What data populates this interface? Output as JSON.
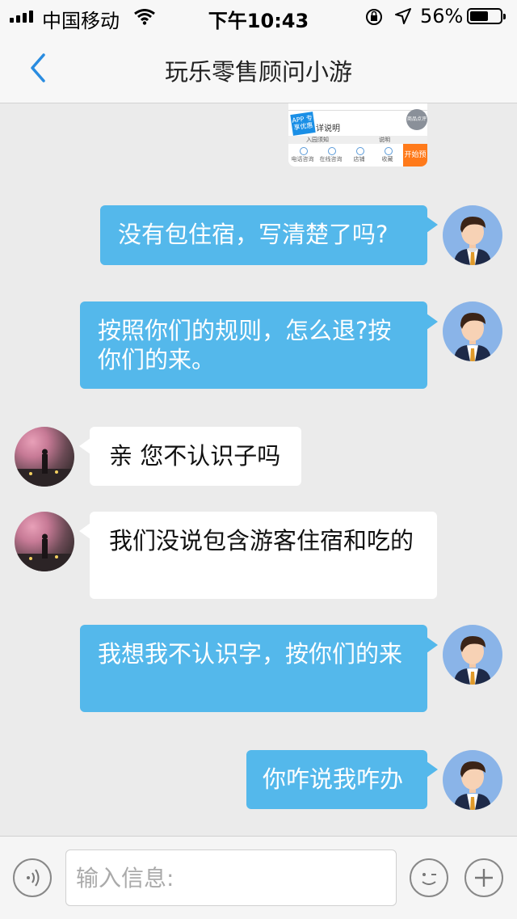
{
  "status_bar": {
    "carrier": "中国移动",
    "time": "下午10:43",
    "battery_percent": "56%"
  },
  "nav": {
    "title": "玩乐零售顾问小游"
  },
  "shared_screenshot": {
    "badge": "APP 专享优惠",
    "desc": "详说明",
    "row_left": "入园须知",
    "row_right": "说明",
    "icons": [
      "电话咨询",
      "在线咨询",
      "店铺",
      "收藏"
    ],
    "side_badge": "商品点评",
    "cta": "开始预"
  },
  "messages": [
    {
      "side": "me",
      "text": "没有包住宿，写清楚了吗?"
    },
    {
      "side": "me",
      "text": "按照你们的规则，怎么退?按你们的来。"
    },
    {
      "side": "other",
      "text": "亲 您不认识子吗"
    },
    {
      "side": "other",
      "text": "我们没说包含游客住宿和吃的"
    },
    {
      "side": "me",
      "text": "我想我不认识字，按你们的来"
    },
    {
      "side": "me",
      "text": "你咋说我咋办"
    }
  ],
  "input": {
    "placeholder": "输入信息:"
  }
}
